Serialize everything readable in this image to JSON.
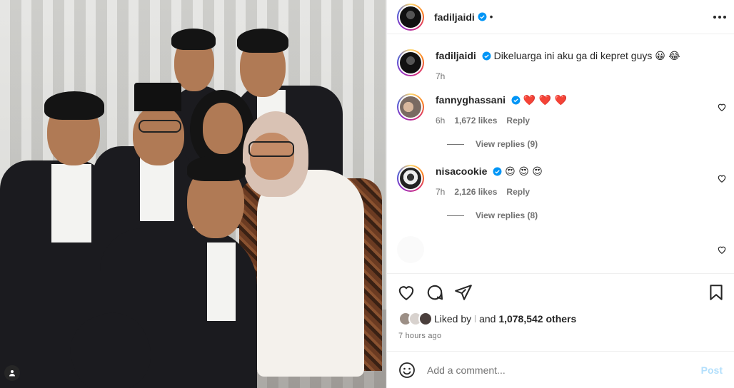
{
  "post": {
    "author": "fadiljaidi",
    "separator": "•",
    "caption_text": "Dikeluarga ini aku ga di kepret guys",
    "caption_emoji": "😀 😂",
    "caption_time": "7h",
    "icons": {
      "more": "more-horizontal-icon",
      "verified": "verified-badge-icon"
    }
  },
  "comments": [
    {
      "user": "fannyghassani",
      "text_emoji": "❤️ ❤️ ❤️",
      "time": "6h",
      "likes": "1,672 likes",
      "reply": "Reply",
      "view_replies": "View replies (9)"
    },
    {
      "user": "nisacookie",
      "text_emoji": "😍 😍 😍",
      "time": "7h",
      "likes": "2,126 likes",
      "reply": "Reply",
      "view_replies": "View replies (8)"
    }
  ],
  "engagement": {
    "liked_by_prefix": "Liked by",
    "liked_by_user": "l",
    "and_text": "and",
    "others_count": "1,078,542 others",
    "timestamp": "7 hours ago"
  },
  "composer": {
    "placeholder": "Add a comment...",
    "post_label": "Post"
  },
  "colors": {
    "verified": "#0095f6",
    "post_disabled": "#b2dffc",
    "secondary_text": "#737373"
  }
}
